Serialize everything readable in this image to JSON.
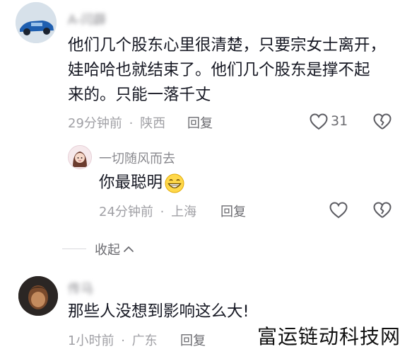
{
  "comments": [
    {
      "username": "A-闫薜",
      "text_lines": [
        "他们几个股东心里很清楚，只要宗女士离开，",
        "娃哈哈也就结束了。他们几个股东是撑不起",
        "来的。只能一落千丈"
      ],
      "time": "29分钟前",
      "location": "陕西",
      "reply_label": "回复",
      "likes": "31"
    },
    {
      "username": "一切随风而去",
      "text": "你最聪明",
      "time": "24分钟前",
      "location": "上海",
      "reply_label": "回复"
    },
    {
      "username": "传马",
      "text": "那些人没想到影响这么大!",
      "time": "1小时前",
      "location": "广东",
      "reply_label": "回复"
    }
  ],
  "collapse_label": "收起",
  "separator": "·",
  "watermark": "富运链动科技网"
}
